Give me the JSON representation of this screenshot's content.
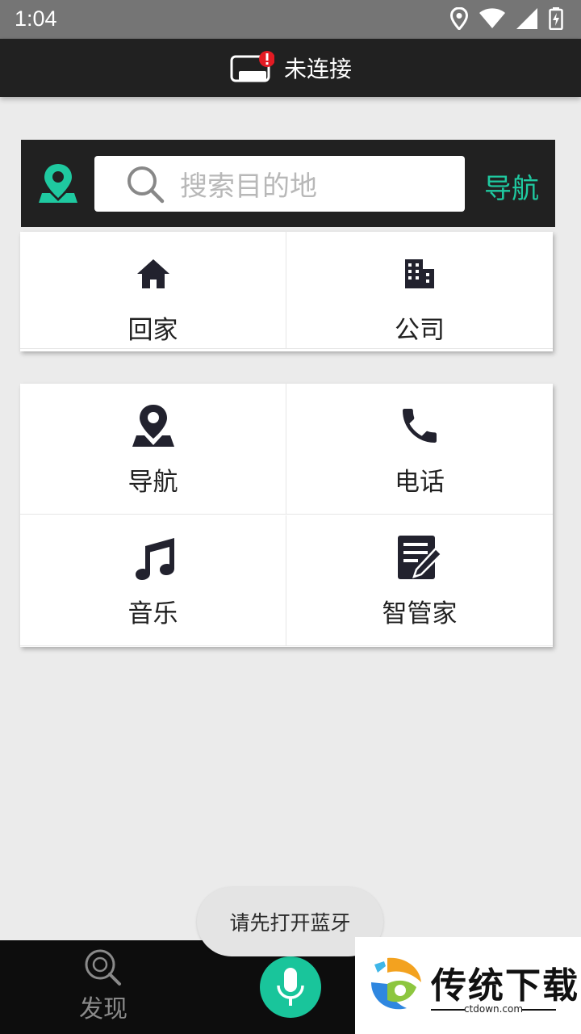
{
  "status_bar": {
    "time": "1:04"
  },
  "app_bar": {
    "title": "未连接"
  },
  "search": {
    "placeholder": "搜索目的地",
    "nav_button": "导航"
  },
  "quick_places": [
    {
      "label": "回家",
      "icon": "home-icon"
    },
    {
      "label": "公司",
      "icon": "building-icon"
    }
  ],
  "features": [
    {
      "label": "导航",
      "icon": "map-pin-icon"
    },
    {
      "label": "电话",
      "icon": "phone-icon"
    },
    {
      "label": "音乐",
      "icon": "music-note-icon"
    },
    {
      "label": "智管家",
      "icon": "note-edit-icon"
    }
  ],
  "toast": "请先打开蓝牙",
  "bottom_nav": {
    "discover_label": "发现"
  },
  "watermark": {
    "text": "传统下载",
    "sub": "ctdown.com"
  },
  "colors": {
    "accent": "#1fc9a0",
    "dark": "#212121",
    "icon_dark": "#22222e"
  }
}
